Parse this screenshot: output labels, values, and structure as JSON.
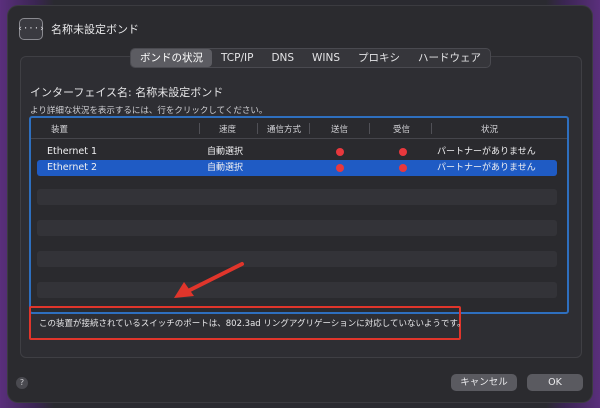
{
  "window": {
    "title": "名称未設定ボンド",
    "icon": "network-brackets-icon",
    "icon_glyph": "‹···›"
  },
  "tabs": [
    {
      "label": "ボンドの状況",
      "active": true
    },
    {
      "label": "TCP/IP",
      "active": false
    },
    {
      "label": "DNS",
      "active": false
    },
    {
      "label": "WINS",
      "active": false
    },
    {
      "label": "プロキシ",
      "active": false
    },
    {
      "label": "ハードウェア",
      "active": false
    }
  ],
  "interface_label": "インターフェイス名: 名称未設定ボンド",
  "hint": "より詳細な状況を表示するには、行をクリックしてください。",
  "table": {
    "headers": [
      "装置",
      "速度",
      "通信方式",
      "送信",
      "受信",
      "状況"
    ],
    "rows": [
      {
        "device": "Ethernet 1",
        "speed": "自動選択",
        "duplex": "",
        "send": "red",
        "receive": "red",
        "status": "パートナーがありません",
        "selected": false
      },
      {
        "device": "Ethernet 2",
        "speed": "自動選択",
        "duplex": "",
        "send": "red",
        "receive": "red",
        "status": "パートナーがありません",
        "selected": true
      }
    ]
  },
  "notice": "この装置が接続されているスイッチのポートは、802.3ad リングアグリゲーションに対応していないようです。",
  "buttons": {
    "help": "?",
    "cancel": "キャンセル",
    "ok": "OK"
  },
  "colors": {
    "accent": "#1f5bc4",
    "table_border": "#2e6fbf",
    "indicator": "#e8383d",
    "annotation": "#e0352b"
  }
}
